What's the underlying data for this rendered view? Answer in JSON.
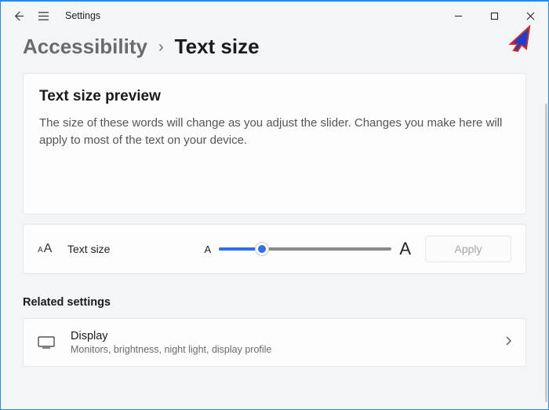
{
  "titlebar": {
    "app": "Settings"
  },
  "breadcrumb": {
    "parent": "Accessibility",
    "sep": "›",
    "current": "Text size"
  },
  "preview": {
    "title": "Text size preview",
    "body": "The size of these words will change as you adjust the slider. Changes you make here will apply to most of the text on your device."
  },
  "slider": {
    "label": "Text size",
    "min_glyph": "A",
    "max_glyph": "A",
    "value_percent": 25,
    "apply": "Apply"
  },
  "related": {
    "heading": "Related settings",
    "display": {
      "title": "Display",
      "subtitle": "Monitors, brightness, night light, display profile"
    }
  }
}
